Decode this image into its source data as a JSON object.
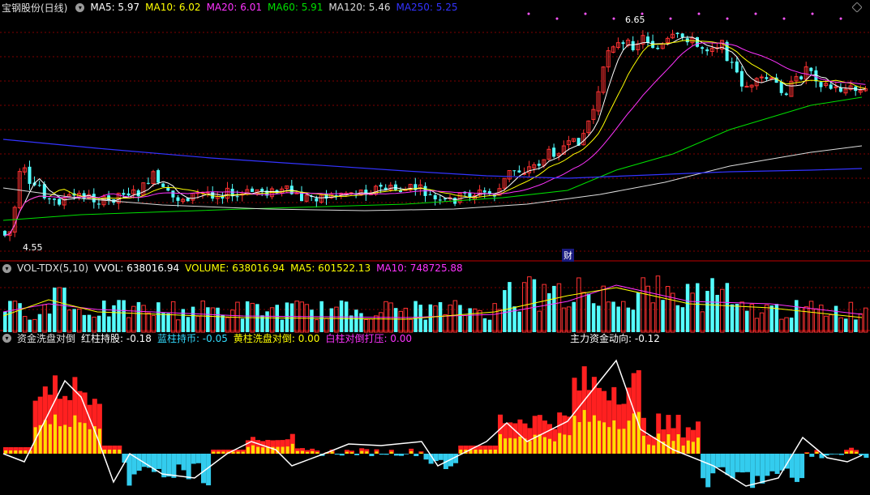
{
  "main": {
    "title": "宝钢股份(日线)",
    "ma": [
      {
        "label": "MA5: 5.97",
        "color": "#ffffff"
      },
      {
        "label": "MA10: 6.02",
        "color": "#ffff00"
      },
      {
        "label": "MA20: 6.01",
        "color": "#ff33ff"
      },
      {
        "label": "MA60: 5.91",
        "color": "#00e000"
      },
      {
        "label": "MA120: 5.46",
        "color": "#dddddd"
      },
      {
        "label": "MA250: 5.25",
        "color": "#3333ff"
      }
    ],
    "high_label": "6.65",
    "low_label": "4.55",
    "event_label": "财"
  },
  "volume": {
    "title": "VOL-TDX(5,10)",
    "items": [
      {
        "label": "VVOL: 638016.94",
        "color": "#ffffff"
      },
      {
        "label": "VOLUME: 638016.94",
        "color": "#ffff00"
      },
      {
        "label": "MA5: 601522.13",
        "color": "#ffff00"
      },
      {
        "label": "MA10: 748725.88",
        "color": "#ff33ff"
      }
    ]
  },
  "indicator": {
    "title": "资金洗盘对倒",
    "items": [
      {
        "label": "红柱持股: -0.18",
        "color": "#ffffff"
      },
      {
        "label": "蓝柱持币: -0.05",
        "color": "#33ddff"
      },
      {
        "label": "黄柱洗盘对倒: 0.00",
        "color": "#ffff00"
      },
      {
        "label": "白柱对倒打压: 0.00",
        "color": "#ff33ff"
      }
    ],
    "flow_label": "主力资金动向: -0.12"
  },
  "colors": {
    "up": "#ff3232",
    "down": "#54ffff",
    "grid": "#800000",
    "border": "#c00000"
  }
}
